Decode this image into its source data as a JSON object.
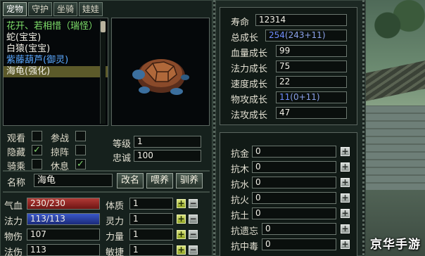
{
  "tabs": [
    "宠物",
    "守护",
    "坐骑",
    "娃娃"
  ],
  "pets": [
    {
      "name": "花开、若相惜（瑞怪）",
      "color": "#7ee06a"
    },
    {
      "name": "蛇(宝宝)",
      "color": "#f0eee4"
    },
    {
      "name": "白猿(宝宝)",
      "color": "#f0eee4"
    },
    {
      "name": "紫藤葫芦(御灵)",
      "color": "#5aa8ff"
    },
    {
      "name": "海龟(强化)",
      "color": "#f0eee4"
    }
  ],
  "flags": {
    "watch": "观看",
    "battle": "参战",
    "hide": "隐藏",
    "formation": "掠阵",
    "ride": "骑乘",
    "rest": "休息"
  },
  "level_label": "等级",
  "level": "1",
  "loyalty_label": "忠诚",
  "loyalty": "100",
  "name_label": "名称",
  "pet_name": "海龟",
  "buttons": {
    "rename": "改名",
    "feed": "喂养",
    "train": "驯养"
  },
  "stats_left": [
    {
      "label": "气血",
      "value": "230/230",
      "type": "hp"
    },
    {
      "label": "法力",
      "value": "113/113",
      "type": "mp"
    },
    {
      "label": "物伤",
      "value": "107",
      "type": "plain"
    },
    {
      "label": "法伤",
      "value": "113",
      "type": "plain"
    }
  ],
  "attributes": [
    {
      "label": "体质",
      "value": "1"
    },
    {
      "label": "灵力",
      "value": "1"
    },
    {
      "label": "力量",
      "value": "1"
    },
    {
      "label": "敏捷",
      "value": "1"
    }
  ],
  "growth": [
    {
      "label": "寿命",
      "value": "12314",
      "accent": false
    },
    {
      "label": "总成长",
      "value": "254",
      "extra": "(243+11)",
      "accent": true
    },
    {
      "label": "血量成长",
      "value": "99",
      "accent": false
    },
    {
      "label": "法力成长",
      "value": "75",
      "accent": false
    },
    {
      "label": "速度成长",
      "value": "22",
      "accent": false
    },
    {
      "label": "物攻成长",
      "value": "11",
      "extra": "(0+11)",
      "accent": true
    },
    {
      "label": "法攻成长",
      "value": "47",
      "accent": false
    }
  ],
  "resistances": [
    {
      "label": "抗金",
      "value": "0"
    },
    {
      "label": "抗木",
      "value": "0"
    },
    {
      "label": "抗水",
      "value": "0"
    },
    {
      "label": "抗火",
      "value": "0"
    },
    {
      "label": "抗土",
      "value": "0"
    },
    {
      "label": "抗遗忘",
      "value": "0"
    },
    {
      "label": "抗中毒",
      "value": "0"
    }
  ],
  "watermark": "京华手游",
  "colors": {
    "accent_blue": "#6f8cff",
    "green_check": "#7fd36c"
  }
}
